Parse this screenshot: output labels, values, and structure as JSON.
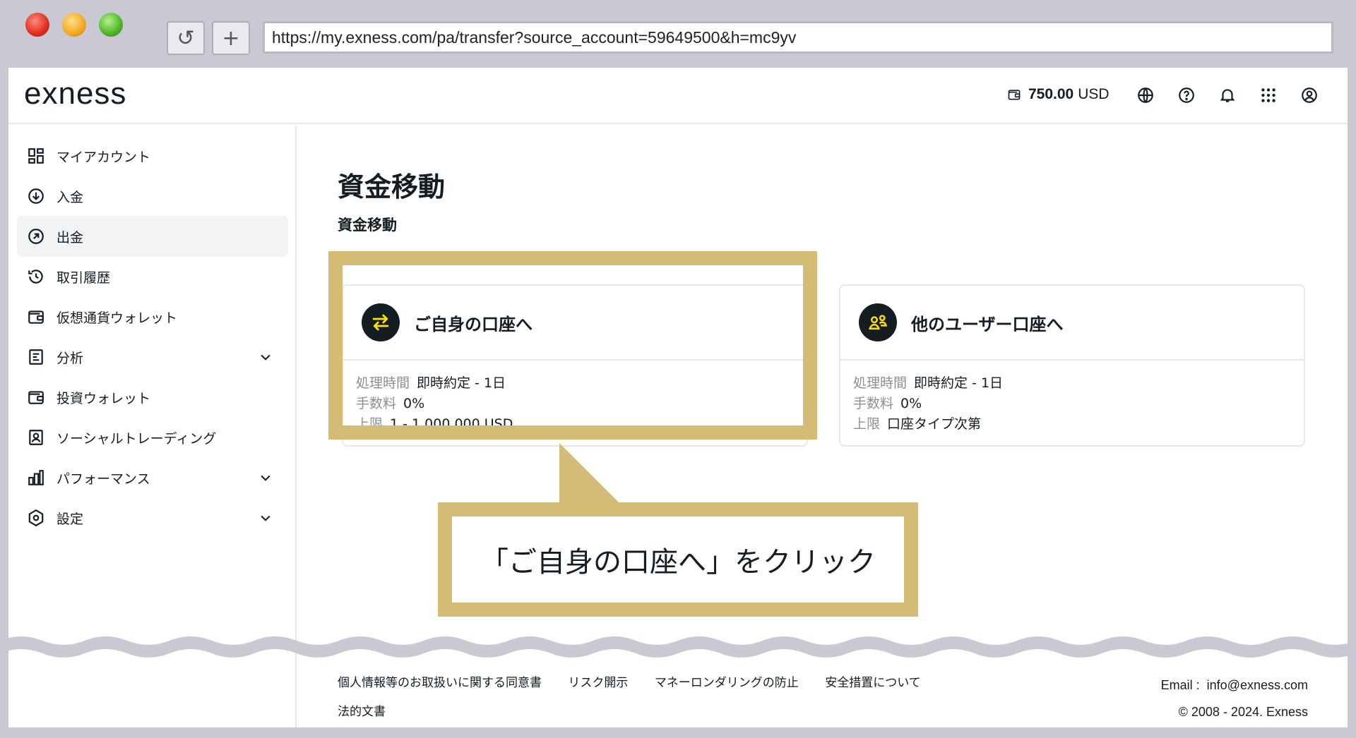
{
  "browser": {
    "url": "https://my.exness.com/pa/transfer?source_account=59649500&h=mc9yv",
    "reload_glyph": "↺",
    "newtab_glyph": "+"
  },
  "header": {
    "logo": "exness",
    "balance_amount": "750.00",
    "balance_currency": "USD",
    "icons": [
      "wallet-icon",
      "globe-icon",
      "help-icon",
      "bell-icon",
      "apps-grid-icon",
      "profile-icon"
    ]
  },
  "sidebar": {
    "items": [
      {
        "label": "マイアカウント",
        "icon": "dashboard-icon"
      },
      {
        "label": "入金",
        "icon": "deposit-icon"
      },
      {
        "label": "出金",
        "icon": "withdraw-icon",
        "active": true
      },
      {
        "label": "取引履歴",
        "icon": "history-icon"
      },
      {
        "label": "仮想通貨ウォレット",
        "icon": "wallet-icon"
      },
      {
        "label": "分析",
        "icon": "analytics-icon",
        "expandable": true
      },
      {
        "label": "投資ウォレット",
        "icon": "wallet-icon"
      },
      {
        "label": "ソーシャルトレーディング",
        "icon": "social-icon"
      },
      {
        "label": "パフォーマンス",
        "icon": "chart-icon",
        "expandable": true
      },
      {
        "label": "設定",
        "icon": "settings-icon",
        "expandable": true
      }
    ]
  },
  "main": {
    "title": "資金移動",
    "subtitle": "資金移動",
    "cards": [
      {
        "title": "ご自身の口座へ",
        "icon": "transfer-arrows-icon",
        "rows": [
          {
            "label": "処理時間",
            "value": "即時約定 - 1日"
          },
          {
            "label": "手数料",
            "value": "0%"
          },
          {
            "label": "上限",
            "value": "1 - 1,000,000 USD"
          }
        ]
      },
      {
        "title": "他のユーザー口座へ",
        "icon": "users-icon",
        "rows": [
          {
            "label": "処理時間",
            "value": "即時約定 - 1日"
          },
          {
            "label": "手数料",
            "value": "0%"
          },
          {
            "label": "上限",
            "value": "口座タイプ次第"
          }
        ]
      }
    ]
  },
  "callout": {
    "text": "「ご自身の口座へ」をクリック"
  },
  "footer": {
    "links": [
      "個人情報等のお取扱いに関する同意書",
      "リスク開示",
      "マネーロンダリングの防止",
      "安全措置について"
    ],
    "legal": "法的文書",
    "email_label": "Email :",
    "email": "info@exness.com",
    "copyright": "© 2008 - 2024. Exness"
  },
  "colors": {
    "highlight": "#d4bc76",
    "accent_yellow": "#ffde02",
    "dark": "#141d22"
  }
}
